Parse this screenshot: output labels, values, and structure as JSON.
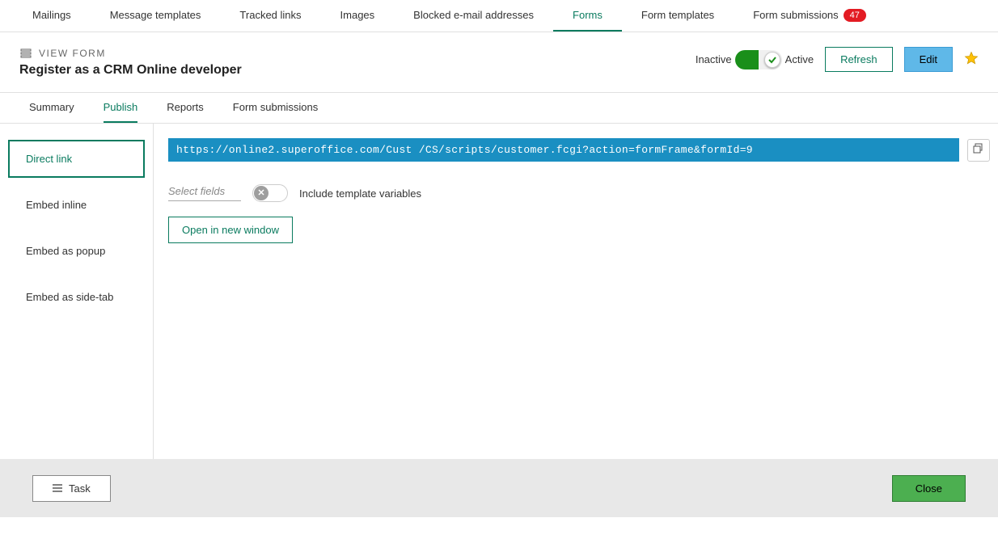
{
  "topNav": {
    "items": [
      {
        "label": "Mailings"
      },
      {
        "label": "Message templates"
      },
      {
        "label": "Tracked links"
      },
      {
        "label": "Images"
      },
      {
        "label": "Blocked e-mail addresses"
      },
      {
        "label": "Forms"
      },
      {
        "label": "Form templates"
      },
      {
        "label": "Form submissions"
      }
    ],
    "badge": "47"
  },
  "header": {
    "viewLabel": "VIEW FORM",
    "title": "Register as a CRM Online developer",
    "toggle": {
      "inactive": "Inactive",
      "active": "Active"
    },
    "refresh": "Refresh",
    "edit": "Edit"
  },
  "subTabs": {
    "items": [
      {
        "label": "Summary"
      },
      {
        "label": "Publish"
      },
      {
        "label": "Reports"
      },
      {
        "label": "Form submissions"
      }
    ]
  },
  "sidebar": {
    "items": [
      {
        "label": "Direct link"
      },
      {
        "label": "Embed inline"
      },
      {
        "label": "Embed as popup"
      },
      {
        "label": "Embed as side-tab"
      }
    ]
  },
  "content": {
    "url": "https://online2.superoffice.com/Cust   /CS/scripts/customer.fcgi?action=formFrame&formId=9",
    "selectFields": "Select fields",
    "includeTemplateVars": "Include template variables",
    "openNewWindow": "Open in new window"
  },
  "footer": {
    "task": "Task",
    "close": "Close"
  }
}
